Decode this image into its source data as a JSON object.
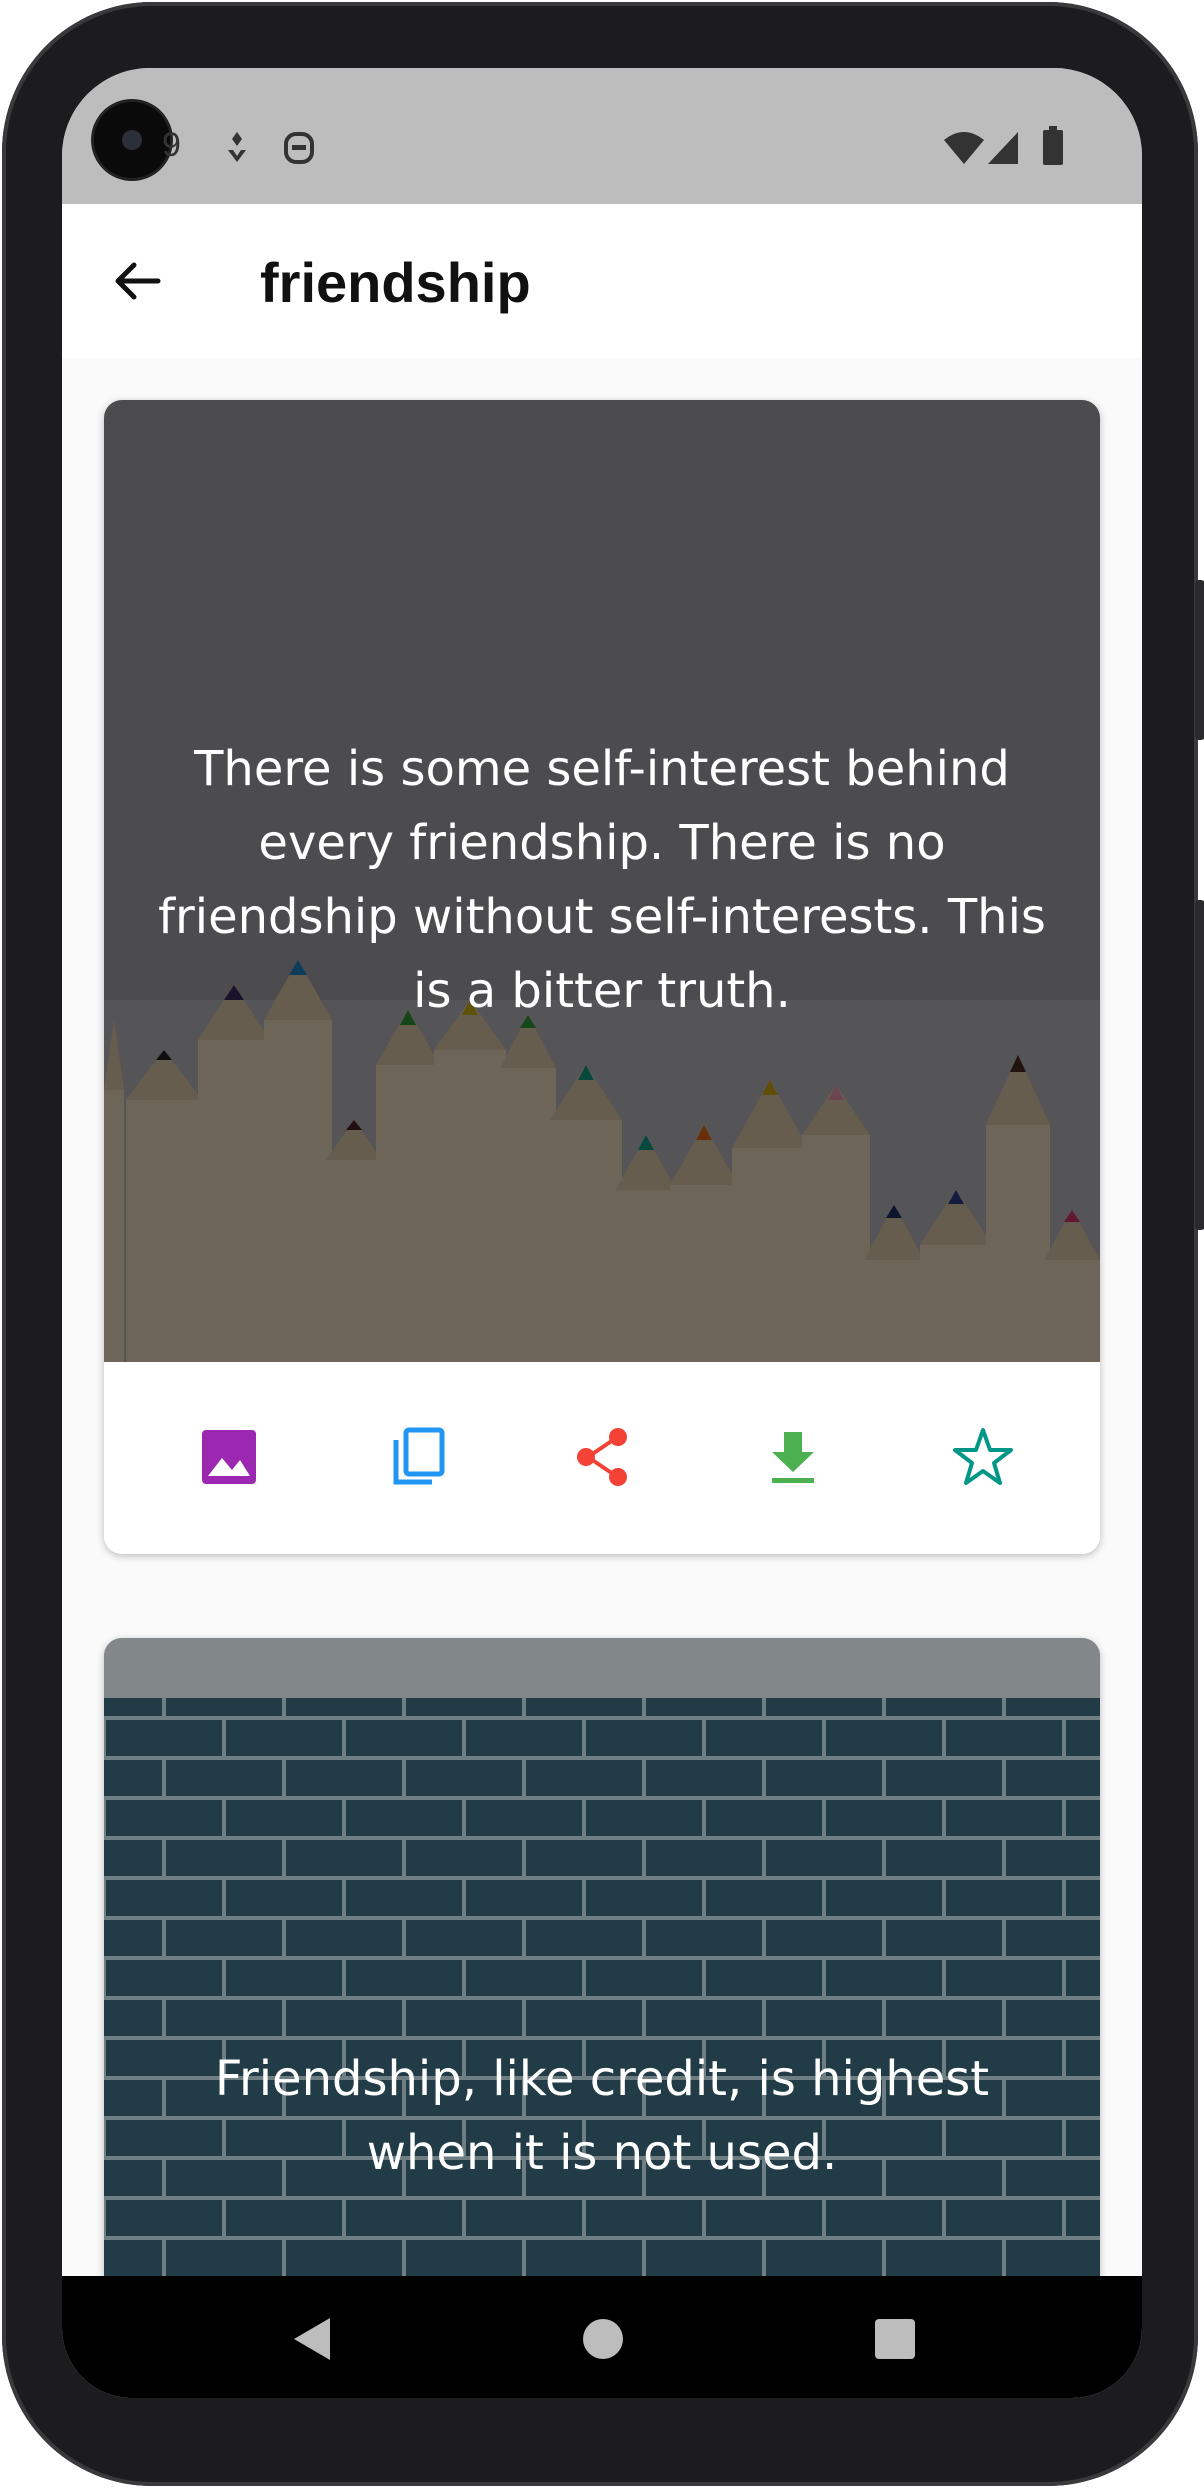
{
  "status_bar": {
    "time": "9"
  },
  "app_bar": {
    "title": "friendship"
  },
  "quotes": [
    {
      "text": "There is some self-interest behind every friendship. There is no friendship without self-interests. This is a bitter truth."
    },
    {
      "text": "Friendship, like credit, is highest when it is not used."
    }
  ],
  "actions": [
    {
      "icon": "image-icon",
      "color": "#9c27b0"
    },
    {
      "icon": "copy-icon",
      "color": "#2196f3"
    },
    {
      "icon": "share-icon",
      "color": "#f44336"
    },
    {
      "icon": "download-icon",
      "color": "#4caf50"
    },
    {
      "icon": "star-outline-icon",
      "color": "#009688"
    }
  ],
  "nav_bar": [
    "back-icon",
    "home-icon",
    "recents-icon"
  ]
}
